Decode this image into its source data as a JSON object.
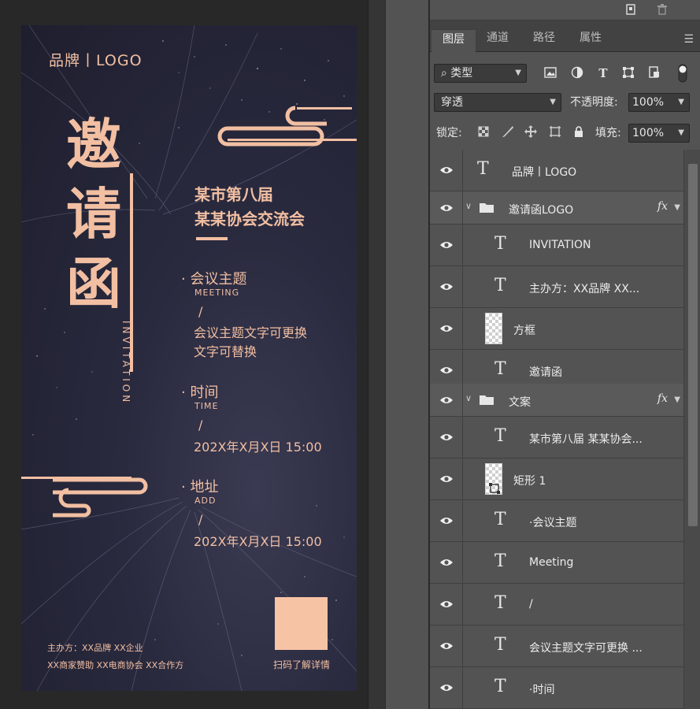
{
  "poster": {
    "brand": "品牌丨LOGO",
    "title_chars": [
      "邀",
      "请",
      "函"
    ],
    "invitation": "INVITATION",
    "headline_line1": "某市第八届",
    "headline_line2": "某某协会交流会",
    "sections": [
      {
        "title": "· 会议主题",
        "sub": "MEETING",
        "slash": "/",
        "body_line1": "会议主题文字可更换",
        "body_line2": "文字可替换"
      },
      {
        "title": "· 时间",
        "sub": "TIME",
        "slash": "/",
        "body_line1": "202X年X月X日  15:00"
      },
      {
        "title": "· 地址",
        "sub": "ADD",
        "slash": "/",
        "body_line1": "202X年X月X日  15:00"
      }
    ],
    "sponsor_line1": "主办方：XX品牌   XX企业",
    "sponsor_line2": "XX商家赞助   XX电商协会   XX合作方",
    "qr_caption": "扫码了解详情",
    "accent_color": "#f2bfa2"
  },
  "panel": {
    "tabs": [
      {
        "label": "图层",
        "active": true
      },
      {
        "label": "通道",
        "active": false
      },
      {
        "label": "路径",
        "active": false
      },
      {
        "label": "属性",
        "active": false
      }
    ],
    "filter_label": "类型",
    "blend_mode": "穿透",
    "opacity_label": "不透明度:",
    "opacity_value": "100%",
    "lock_label": "锁定:",
    "fill_label": "填充:",
    "fill_value": "100%",
    "layers": [
      {
        "kind": "text",
        "name": "品牌丨LOGO",
        "indent": 0
      },
      {
        "kind": "group",
        "name": "邀请函LOGO",
        "fx": "fx"
      },
      {
        "kind": "text",
        "name": "INVITATION",
        "indent": 1
      },
      {
        "kind": "text",
        "name": "主办方：XX品牌  XX...",
        "indent": 1
      },
      {
        "kind": "pixel",
        "name": "方框",
        "indent": 1
      },
      {
        "kind": "text",
        "name": "邀请函",
        "indent": 1
      },
      {
        "kind": "group",
        "name": "文案",
        "fx": "fx"
      },
      {
        "kind": "text",
        "name": "某市第八届 某某协会...",
        "indent": 1
      },
      {
        "kind": "shape",
        "name": "矩形 1",
        "indent": 1
      },
      {
        "kind": "text",
        "name": "·会议主题",
        "indent": 1
      },
      {
        "kind": "text",
        "name": "Meeting",
        "indent": 1
      },
      {
        "kind": "text",
        "name": "/",
        "indent": 1
      },
      {
        "kind": "text",
        "name": "会议主题文字可更换 ...",
        "indent": 1
      },
      {
        "kind": "text",
        "name": "·时间",
        "indent": 1
      }
    ]
  }
}
